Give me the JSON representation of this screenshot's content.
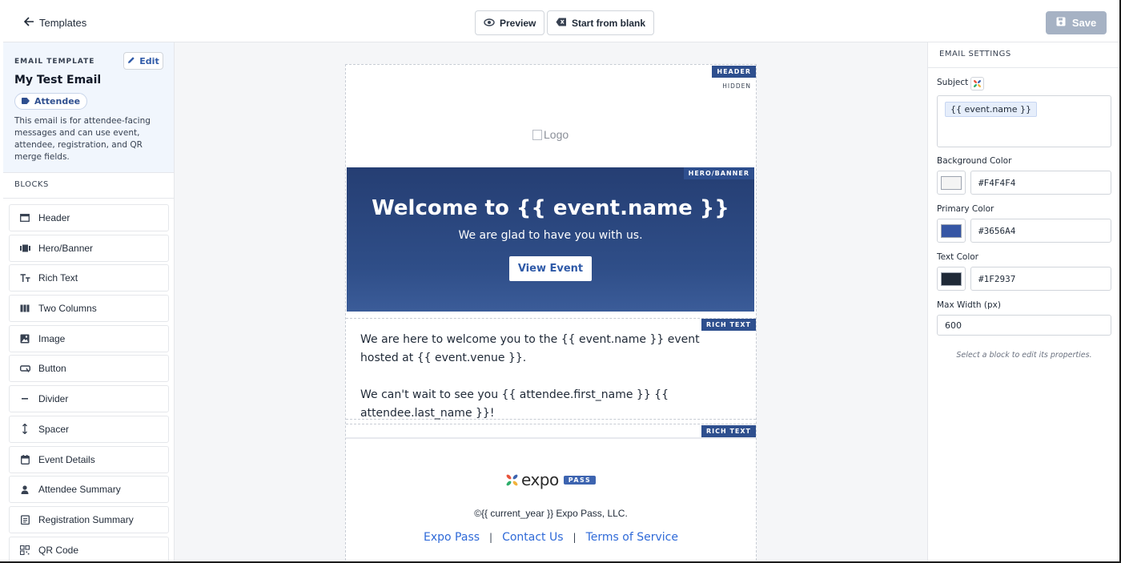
{
  "topbar": {
    "back_label": "Templates",
    "preview_label": "Preview",
    "start_blank_label": "Start from blank",
    "save_label": "Save"
  },
  "template": {
    "caption": "EMAIL TEMPLATE",
    "edit_label": "Edit",
    "name": "My Test Email",
    "audience_badge": "Attendee",
    "description": "This email is for attendee-facing messages and can use event, attendee, registration, and QR merge fields."
  },
  "blocks": {
    "caption": "BLOCKS",
    "items": [
      {
        "label": "Header",
        "icon": "header-block-icon"
      },
      {
        "label": "Hero/Banner",
        "icon": "hero-block-icon"
      },
      {
        "label": "Rich Text",
        "icon": "rich-text-icon"
      },
      {
        "label": "Two Columns",
        "icon": "columns-icon"
      },
      {
        "label": "Image",
        "icon": "image-icon"
      },
      {
        "label": "Button",
        "icon": "button-icon"
      },
      {
        "label": "Divider",
        "icon": "divider-icon"
      },
      {
        "label": "Spacer",
        "icon": "spacer-icon"
      },
      {
        "label": "Event Details",
        "icon": "calendar-icon"
      },
      {
        "label": "Attendee Summary",
        "icon": "person-icon"
      },
      {
        "label": "Registration Summary",
        "icon": "clipboard-icon"
      },
      {
        "label": "QR Code",
        "icon": "qr-code-icon"
      }
    ]
  },
  "email_preview": {
    "header": {
      "tag": "HEADER",
      "hidden_tag": "HIDDEN",
      "logo_alt": "Logo"
    },
    "hero": {
      "tag": "HERO/BANNER",
      "title": "Welcome to {{ event.name }}",
      "subtitle": "We are glad to have you with us.",
      "button_label": "View Event"
    },
    "rich_text_1": {
      "tag": "RICH TEXT",
      "paragraph_1": "We are here to welcome you to the {{ event.name }} event hosted at {{ event.venue }}.",
      "paragraph_2": "We can't wait to see you {{ attendee.first_name }} {{ attendee.last_name }}!"
    },
    "rich_text_2": {
      "tag": "RICH TEXT"
    },
    "footer": {
      "logo_word": "expo",
      "logo_badge": "PASS",
      "copyright": "©{{ current_year }} Expo Pass, LLC.",
      "links": [
        "Expo Pass",
        "Contact Us",
        "Terms of Service"
      ],
      "separator": "|"
    }
  },
  "settings": {
    "caption": "EMAIL SETTINGS",
    "subject_label": "Subject",
    "subject_value": "{{ event.name }}",
    "background_label": "Background Color",
    "background_value": "#F4F4F4",
    "primary_label": "Primary Color",
    "primary_value": "#3656A4",
    "text_label": "Text Color",
    "text_value": "#1F2937",
    "max_width_label": "Max Width (px)",
    "max_width_value": "600",
    "hint": "Select a block to edit its properties."
  },
  "colors": {
    "accent": "#2F5AA8",
    "tag_bg": "#2E4F8E",
    "save_disabled": "#A6B2C4",
    "link": "#2F6AD8"
  }
}
